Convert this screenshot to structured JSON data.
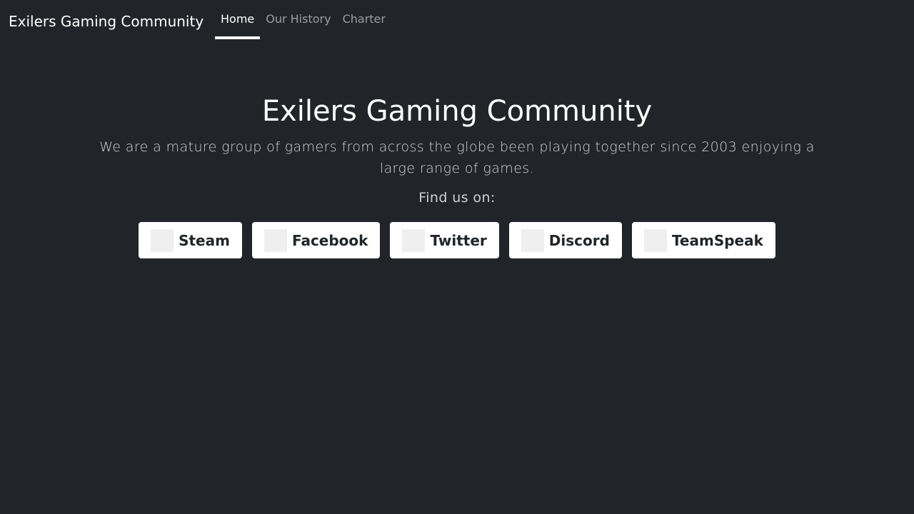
{
  "navbar": {
    "brand": "Exilers Gaming Community",
    "links": [
      {
        "label": "Home",
        "active": true
      },
      {
        "label": "Our History",
        "active": false
      },
      {
        "label": "Charter",
        "active": false
      }
    ]
  },
  "hero": {
    "title": "Exilers Gaming Community",
    "lead": "We are a mature group of gamers from across the globe been playing together since 2003 enjoying a large range of games.",
    "find_us": "Find us on:"
  },
  "social": [
    {
      "label": "Steam",
      "icon": "steam-icon"
    },
    {
      "label": "Facebook",
      "icon": "facebook-icon"
    },
    {
      "label": "Twitter",
      "icon": "twitter-icon"
    },
    {
      "label": "Discord",
      "icon": "discord-icon"
    },
    {
      "label": "TeamSpeak",
      "icon": "teamspeak-icon"
    }
  ],
  "colors": {
    "background": "#212529",
    "button_bg": "#ffffff",
    "button_text": "#212529",
    "nav_inactive": "rgba(255,255,255,0.55)"
  }
}
